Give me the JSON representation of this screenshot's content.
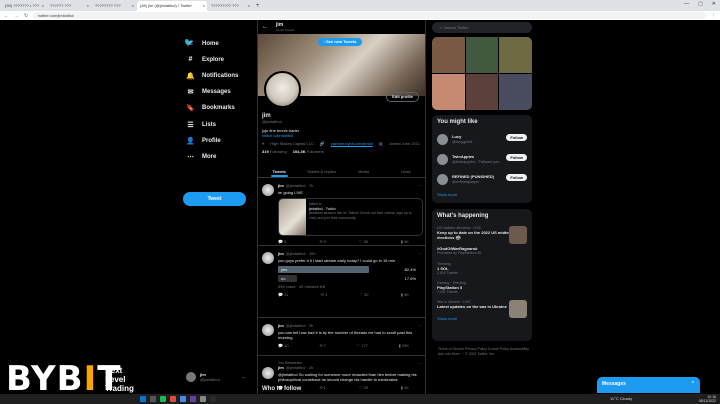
{
  "browser": {
    "tabs": [
      {
        "label": "(93) ??????? • ???"
      },
      {
        "label": "?????? ???"
      },
      {
        "label": "???????? ???"
      },
      {
        "label": "(48) jim (@jimlatibol) / Twitter",
        "active": true
      },
      {
        "label": "????????? ???"
      }
    ],
    "url": "twitter.com/jimlatibol",
    "new_tab": "+"
  },
  "nav": {
    "items": [
      {
        "icon": "home-icon",
        "label": "Home"
      },
      {
        "icon": "hashtag-icon",
        "label": "Explore"
      },
      {
        "icon": "bell-icon",
        "label": "Notifications"
      },
      {
        "icon": "mail-icon",
        "label": "Messages"
      },
      {
        "icon": "bookmark-icon",
        "label": "Bookmarks"
      },
      {
        "icon": "list-icon",
        "label": "Lists"
      },
      {
        "icon": "person-icon",
        "label": "Profile"
      },
      {
        "icon": "more-icon",
        "label": "More"
      }
    ],
    "tweet_button": "Tweet",
    "account": {
      "name": "jim",
      "handle": "@jimlatibol"
    }
  },
  "profile": {
    "header_name": "jim",
    "header_sub": "10,4K Tweets",
    "see_new": "↑ See new Tweets",
    "edit_button": "Edit profile",
    "display_name": "jim",
    "handle": "@jimlatibol",
    "bio": "juju fine tennis trader",
    "bio_link": "twitch.tv/jimlatibol",
    "location": "High Stakes Capital LLC",
    "website": "panther.bybit.com/jimlat",
    "joined": "Joined June 2011",
    "following_count": "319",
    "following_label": "Following",
    "followers_count": "104,3K",
    "followers_label": "Followers",
    "tabs": [
      "Tweets",
      "Tweets & replies",
      "Media",
      "Likes"
    ]
  },
  "tweets": [
    {
      "name": "jim",
      "handle": "@jimlatibol · 7h",
      "text": "im going LIVE",
      "card": {
        "domain": "twitch.tv",
        "title": "jimlatibol - Twitch",
        "desc": "jimlatibol streams live on Twitch! Check out their videos, sign up to chat, and join their community."
      },
      "actions": {
        "reply": "3",
        "retweet": "3",
        "like": "38",
        "views": "9K"
      }
    },
    {
      "name": "jim",
      "handle": "@jimlatibol · 10h",
      "text": "you guys prefer it if I start stream early today? I could go in 15 min",
      "poll": [
        {
          "label": "yes",
          "pct": "82.4%",
          "value": 82.4
        },
        {
          "label": "no",
          "pct": "17.6%",
          "value": 17.6
        }
      ],
      "poll_meta": "595 votes · 45 minutes left",
      "actions": {
        "reply": "11",
        "retweet": "1",
        "like": "32",
        "views": "9K"
      }
    },
    {
      "name": "jim",
      "handle": "@jimlatibol · 2h",
      "text": "you can tell how bad it is by the number of threads ive had to scroll past this morning",
      "actions": {
        "reply": "10",
        "retweet": "7",
        "like": "177",
        "views": "25K"
      }
    },
    {
      "retweeted": "You Retweeted",
      "name": "jim",
      "handle": "@jimlatibol · 2h",
      "text": "@jimlatibol So waiting for someone more redacted than him before making his philosophical comeback he should change his handle to medicrates",
      "actions": {
        "reply": "2",
        "retweet": "1",
        "like": "29",
        "views": "2K"
      }
    }
  ],
  "who_to_follow": "Who to follow",
  "sidebar": {
    "search_placeholder": "Search Twitter",
    "you_might_like": "You might like",
    "suggestions": [
      {
        "name": "Lucy",
        "handle": "@lucygeert",
        "button": "Follow"
      },
      {
        "name": "TwinApples",
        "handle": "@twinapples · Follows you",
        "button": "Follow"
      },
      {
        "name": "REFINED (PUNISHED)",
        "handle": "@refinedplayer",
        "button": "Follow"
      }
    ],
    "show_more": "Show more",
    "whats_happening": "What's happening",
    "trends": [
      {
        "meta": "US midterm elections · LIVE",
        "title": "Keep up to date on the 2022 US midterm elections 🗳",
        "sub": ""
      },
      {
        "meta": "",
        "title": "#GodOfWarRagnarok",
        "sub": "Promoted by PlayStation UK"
      },
      {
        "meta": "Trending",
        "title": "1 SOL",
        "sub": "2,818 Tweets"
      },
      {
        "meta": "Gaming · Trending",
        "title": "PlayStation 5",
        "sub": "7,241 Tweets"
      },
      {
        "meta": "War in Ukraine · LIVE",
        "title": "Latest updates on the war in Ukraine",
        "sub": ""
      }
    ],
    "show_more2": "Show more",
    "footer": "Terms of Service  Privacy Policy  Cookie Policy  Accessibility  Ads info  More ···  © 2022 Twitter, Inc."
  },
  "messages_bar": "Messages",
  "overlay": {
    "brand_left": "BYB",
    "brand_bar": "I",
    "brand_right": "T",
    "tagline1": "Next",
    "tagline2": "Level",
    "tagline3": "Trading"
  },
  "system": {
    "weather": "11°C Cloudy",
    "time": "10:16",
    "date": "08/11/2022"
  },
  "colors": {
    "accent": "#1d9bf0",
    "brand": "#f7a600",
    "background": "#000000"
  }
}
